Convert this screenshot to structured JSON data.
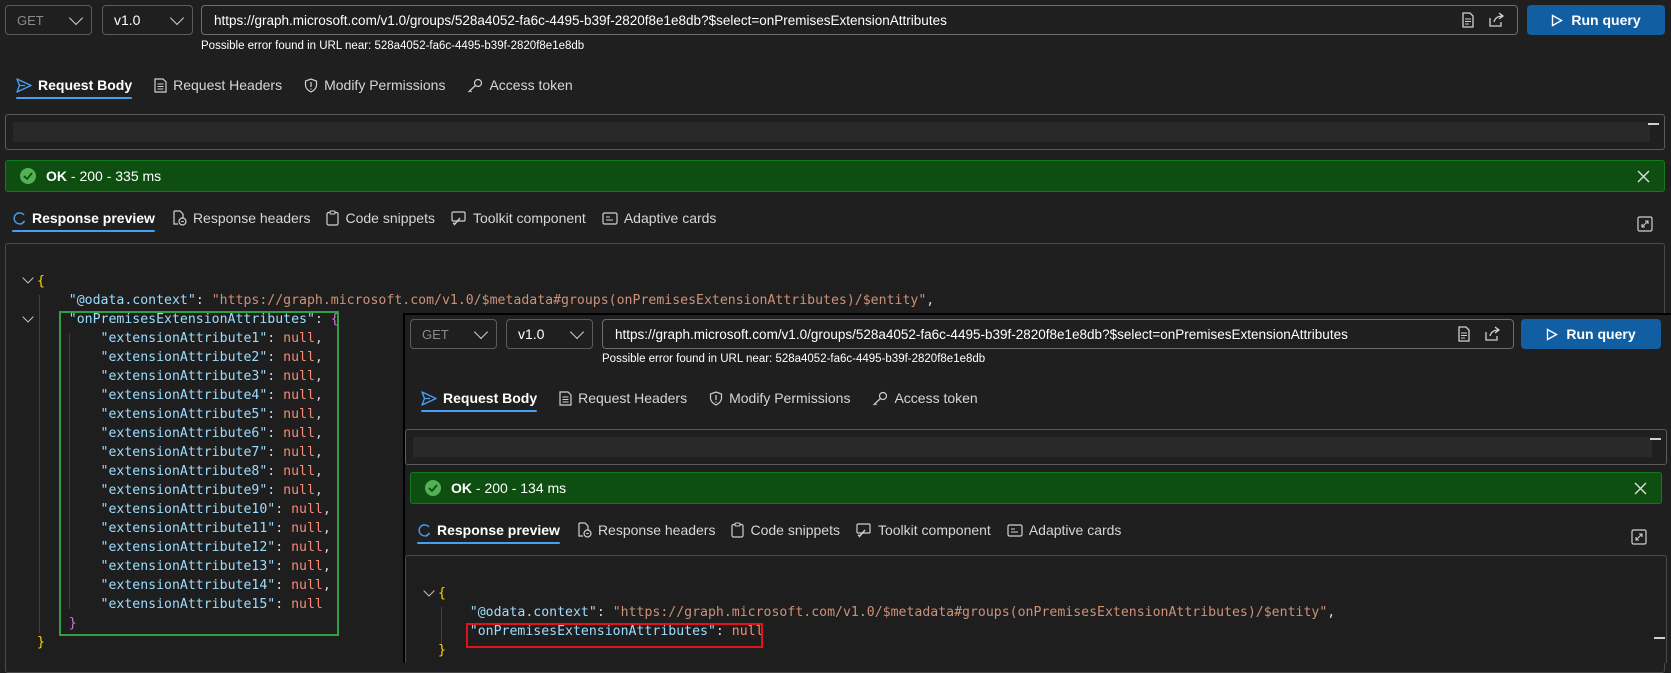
{
  "request": {
    "method": "GET",
    "version": "v1.0",
    "url": "https://graph.microsoft.com/v1.0/groups/528a4052-fa6c-4495-b39f-2820f8e1e8db?$select=onPremisesExtensionAttributes",
    "error_hint": "Possible error found in URL near: 528a4052-fa6c-4495-b39f-2820f8e1e8db",
    "run_label": "Run query"
  },
  "request_tabs": [
    "Request Body",
    "Request Headers",
    "Modify Permissions",
    "Access token"
  ],
  "response_tabs": [
    "Response preview",
    "Response headers",
    "Code snippets",
    "Toolkit component",
    "Adaptive cards"
  ],
  "status": {
    "primary": {
      "ok": "OK",
      "detail": " - 200 - 335 ms"
    },
    "secondary": {
      "ok": "OK",
      "detail": " - 200 - 134 ms"
    }
  },
  "response_primary": {
    "context_key": "\"@odata.context\"",
    "context_value": "\"https://graph.microsoft.com/v1.0/$metadata#groups(onPremisesExtensionAttributes)/$entity\"",
    "ext_key": "\"onPremisesExtensionAttributes\"",
    "attributes": [
      {
        "key": "\"extensionAttribute1\"",
        "value": "null",
        "sep": ","
      },
      {
        "key": "\"extensionAttribute2\"",
        "value": "null",
        "sep": ","
      },
      {
        "key": "\"extensionAttribute3\"",
        "value": "null",
        "sep": ","
      },
      {
        "key": "\"extensionAttribute4\"",
        "value": "null",
        "sep": ","
      },
      {
        "key": "\"extensionAttribute5\"",
        "value": "null",
        "sep": ","
      },
      {
        "key": "\"extensionAttribute6\"",
        "value": "null",
        "sep": ","
      },
      {
        "key": "\"extensionAttribute7\"",
        "value": "null",
        "sep": ","
      },
      {
        "key": "\"extensionAttribute8\"",
        "value": "null",
        "sep": ","
      },
      {
        "key": "\"extensionAttribute9\"",
        "value": "null",
        "sep": ","
      },
      {
        "key": "\"extensionAttribute10\"",
        "value": "null",
        "sep": ","
      },
      {
        "key": "\"extensionAttribute11\"",
        "value": "null",
        "sep": ","
      },
      {
        "key": "\"extensionAttribute12\"",
        "value": "null",
        "sep": ","
      },
      {
        "key": "\"extensionAttribute13\"",
        "value": "null",
        "sep": ","
      },
      {
        "key": "\"extensionAttribute14\"",
        "value": "null",
        "sep": ","
      },
      {
        "key": "\"extensionAttribute15\"",
        "value": "null",
        "sep": ""
      }
    ]
  },
  "response_secondary": {
    "context_key": "\"@odata.context\"",
    "context_value": "\"https://graph.microsoft.com/v1.0/$metadata#groups(onPremisesExtensionAttributes)/$entity\"",
    "ext_key": "\"onPremisesExtensionAttributes\"",
    "ext_value": "null"
  },
  "icons": {
    "send": "send-icon",
    "headers": "document-icon",
    "permissions": "shield-icon",
    "token": "key-icon",
    "preview": "arrow-icon",
    "snippets": "clipboard-icon",
    "toolkit": "wrench-icon",
    "cards": "card-icon",
    "share": "share-icon",
    "docs": "docs-icon",
    "close": "close-icon",
    "expand": "expand-icon",
    "ok": "checkmark-icon"
  },
  "colors": {
    "accent": "#115ea3",
    "tab_underline": "#479ef5",
    "status_bg": "#0e4f11",
    "green_highlight": "#2ea043",
    "red_highlight": "#e0121b"
  }
}
